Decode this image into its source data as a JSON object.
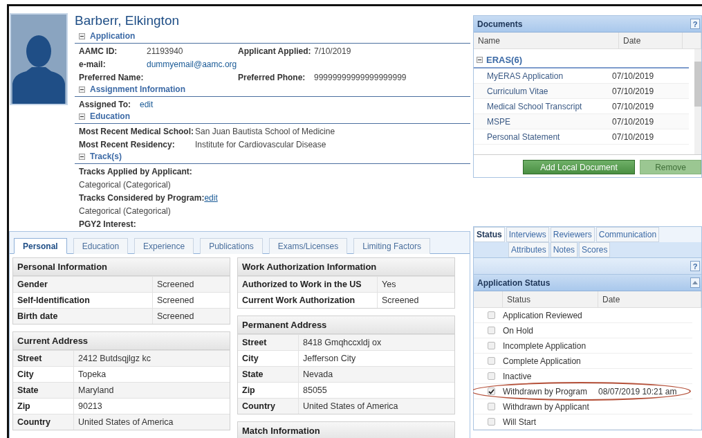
{
  "applicant": {
    "name": "Barberr, Elkington",
    "sections": [
      {
        "title": "Application",
        "kind": "grid4",
        "rows": [
          [
            {
              "label": "AAMC ID:",
              "value": "21193940"
            },
            {
              "label": "Applicant Applied:",
              "value": "7/10/2019"
            }
          ],
          [
            {
              "label": "e-mail:",
              "value": "dummyemail@aamc.org",
              "kind": "link"
            }
          ],
          [
            {
              "label": "Preferred Name:"
            },
            {
              "label": "Preferred Phone:",
              "value": "99999999999999999999"
            }
          ]
        ]
      },
      {
        "title": "Assignment Information",
        "kind": "inline",
        "rows": [
          [
            {
              "label": "Assigned To:",
              "value": "edit",
              "kind": "link"
            }
          ]
        ]
      },
      {
        "title": "Education",
        "kind": "grid2",
        "rows": [
          [
            {
              "label": "Most Recent Medical School:",
              "value": "San Juan Bautista School of Medicine"
            }
          ],
          [
            {
              "label": "Most Recent Residency:",
              "value": "Institute for Cardiovascular Disease"
            }
          ]
        ]
      },
      {
        "title": "Track(s)",
        "kind": "lines",
        "rows": [
          [
            {
              "label": "Tracks Applied by Applicant:"
            }
          ],
          [
            {
              "value": "Categorical (Categorical)"
            }
          ],
          [
            {
              "label": "Tracks Considered by Program:",
              "value": "edit",
              "kind": "underlined_link"
            }
          ],
          [
            {
              "value": "Categorical (Categorical)"
            }
          ],
          [
            {
              "label": "PGY2 Interest:"
            }
          ]
        ]
      }
    ]
  },
  "profile_tabs": [
    {
      "label": "Personal",
      "selected": true
    },
    {
      "label": "Education",
      "selected": false
    },
    {
      "label": "Experience",
      "selected": false
    },
    {
      "label": "Publications",
      "selected": false
    },
    {
      "label": "Exams/Licenses",
      "selected": false
    },
    {
      "label": "Limiting Factors",
      "selected": false
    }
  ],
  "cards_left": [
    {
      "title": "Personal Information",
      "kind": "wide",
      "rows": [
        [
          "Gender",
          "Screened"
        ],
        [
          "Self-Identification",
          "Screened"
        ],
        [
          "Birth date",
          "Screened"
        ]
      ]
    },
    {
      "title": "Current Address",
      "kind": "narrow",
      "rows": [
        [
          "Street",
          "2412 Butdsqjlgz kc"
        ],
        [
          "City",
          "Topeka"
        ],
        [
          "State",
          "Maryland"
        ],
        [
          "Zip",
          "90213"
        ],
        [
          "Country",
          "United States of America"
        ]
      ]
    }
  ],
  "cards_right": [
    {
      "title": "Work Authorization Information",
      "kind": "wide",
      "rows": [
        [
          "Authorized to Work in the US",
          "Yes"
        ],
        [
          "Current Work Authorization",
          "Screened"
        ]
      ]
    },
    {
      "title": "Permanent Address",
      "kind": "narrow",
      "rows": [
        [
          "Street",
          "8418 Gmqhccxldj ox"
        ],
        [
          "City",
          "Jefferson City"
        ],
        [
          "State",
          "Nevada"
        ],
        [
          "Zip",
          "85055"
        ],
        [
          "Country",
          "United States of America"
        ]
      ]
    },
    {
      "title": "Match Information"
    }
  ],
  "documents": {
    "title": "Documents",
    "help": "?",
    "columns": [
      "Name",
      "Date"
    ],
    "group": {
      "title": "ERAS(6)"
    },
    "rows": [
      {
        "name": "MyERAS Application",
        "date": "07/10/2019"
      },
      {
        "name": "Curriculum Vitae",
        "date": "07/10/2019"
      },
      {
        "name": "Medical School Transcript",
        "date": "07/10/2019"
      },
      {
        "name": "MSPE",
        "date": "07/10/2019"
      },
      {
        "name": "Personal Statement",
        "date": "07/10/2019"
      }
    ],
    "buttons": [
      {
        "label": "Add Local Document",
        "disabled": false
      },
      {
        "label": "Remove",
        "disabled": true
      }
    ]
  },
  "status_tabs": [
    [
      {
        "label": "Status",
        "selected": true
      },
      {
        "label": "Interviews",
        "selected": false
      },
      {
        "label": "Reviewers",
        "selected": false
      },
      {
        "label": "Communication",
        "selected": false
      }
    ],
    [
      {
        "label": "Attributes",
        "selected": false
      },
      {
        "label": "Notes",
        "selected": false
      },
      {
        "label": "Scores",
        "selected": false
      }
    ]
  ],
  "status_help": "?",
  "application_status": {
    "title": "Application Status",
    "columns": [
      "Status",
      "Date"
    ],
    "rows": [
      {
        "status": "Application Reviewed",
        "checked": false,
        "circled": false
      },
      {
        "status": "On Hold",
        "checked": false,
        "circled": false
      },
      {
        "status": "Incomplete Application",
        "checked": false,
        "circled": false
      },
      {
        "status": "Complete Application",
        "checked": false,
        "circled": false
      },
      {
        "status": "Inactive",
        "checked": false,
        "circled": false
      },
      {
        "status": "Withdrawn by Program",
        "date": "08/07/2019 10:21 am",
        "checked": true,
        "circled": true
      },
      {
        "status": "Withdrawn by Applicant",
        "checked": false,
        "circled": false
      },
      {
        "status": "Will Start",
        "checked": false,
        "circled": false
      }
    ]
  }
}
